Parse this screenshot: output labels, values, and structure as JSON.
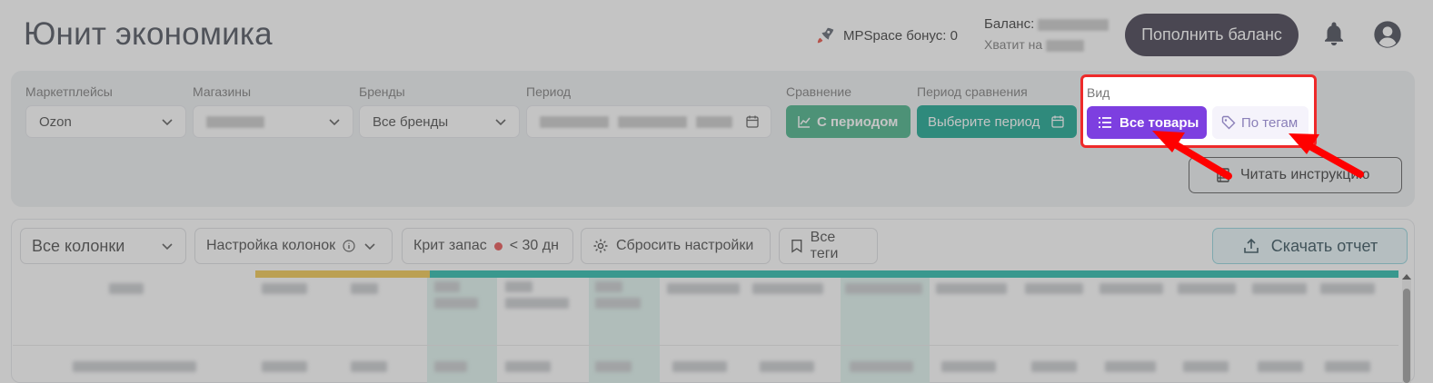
{
  "header": {
    "title": "Юнит экономика",
    "bonus_label": "MPSpace бонус: 0",
    "balance_label": "Баланс:",
    "enough_label": "Хватит на",
    "topup_label": "Пополнить баланс"
  },
  "filters": {
    "marketplaces": {
      "label": "Маркетплейсы",
      "value": "Ozon"
    },
    "stores": {
      "label": "Магазины",
      "value": ""
    },
    "brands": {
      "label": "Бренды",
      "value": "Все бренды"
    },
    "period": {
      "label": "Период",
      "value": ""
    },
    "comparison": {
      "label": "Сравнение",
      "button": "С периодом"
    },
    "comparison_period": {
      "label": "Период сравнения",
      "button": "Выберите период"
    },
    "view": {
      "label": "Вид",
      "all_items": "Все товары",
      "by_tags": "По тегам"
    },
    "instructions_label": "Читать инструкцию"
  },
  "toolbar": {
    "columns_select": "Все колонки",
    "columns_settings": "Настройка колонок",
    "crit_stock_label": "Крит запас",
    "crit_stock_value": "< 30 дн",
    "reset_label": "Сбросить настройки",
    "all_tags_label": "Все теги",
    "download_label": "Скачать отчет"
  },
  "colors": {
    "purple": "#7d3fe0",
    "teal": "#0fa28c",
    "highlight_red": "#ee2a2a"
  }
}
